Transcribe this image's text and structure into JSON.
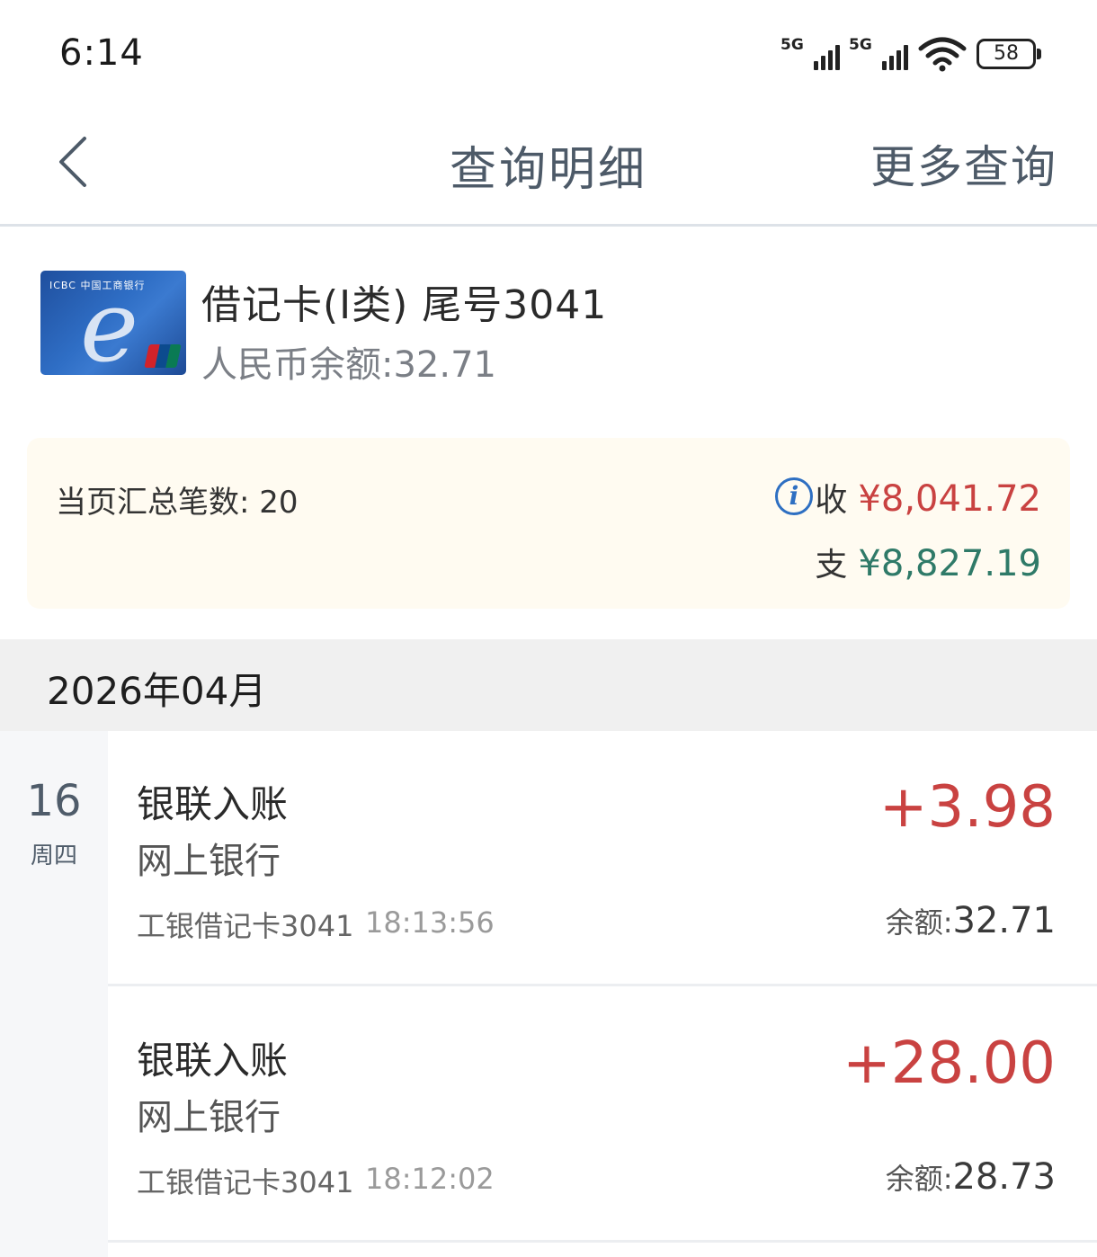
{
  "status_bar": {
    "time": "6:14",
    "network_1": "5G",
    "network_2": "5G",
    "battery": "58"
  },
  "header": {
    "title": "查询明细",
    "more_link": "更多查询"
  },
  "account": {
    "card_title": "借记卡(I类) 尾号3041",
    "balance_label": "人民币余额:32.71",
    "card_brand": "ICBC 中国工商银行"
  },
  "summary": {
    "count_label": "当页汇总笔数: 20",
    "income_label": "收",
    "income_amount": "¥8,041.72",
    "expense_label": "支",
    "expense_amount": "¥8,827.19"
  },
  "month": "2026年04月",
  "date_group": {
    "day": "16",
    "weekday": "周四"
  },
  "transactions": [
    {
      "type": "银联入账",
      "channel": "网上银行",
      "card": "工银借记卡3041",
      "time": "18:13:56",
      "amount": "+3.98",
      "balance_label": "余额:",
      "balance_value": "32.71"
    },
    {
      "type": "银联入账",
      "channel": "网上银行",
      "card": "工银借记卡3041",
      "time": "18:12:02",
      "amount": "+28.00",
      "balance_label": "余额:",
      "balance_value": "28.73"
    }
  ],
  "colors": {
    "income": "#c94241",
    "expense": "#2f7a68",
    "summary_bg": "#fffbf1",
    "header_text": "#4d5a68"
  }
}
